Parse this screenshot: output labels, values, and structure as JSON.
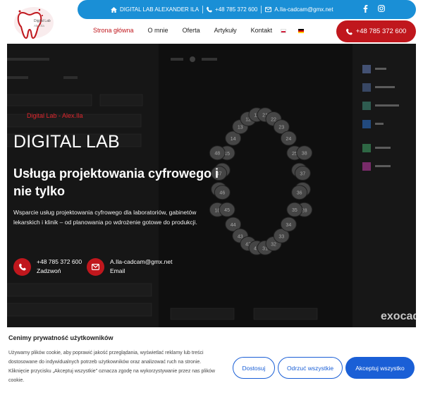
{
  "logo": {
    "text_main": "Digital Lab",
    "text_sub": "Alex.Ila"
  },
  "topbar": {
    "company": "DIGITAL LAB ALEXANDER ILA",
    "phone": "+48 785 372 600",
    "email": "A.Ila-cadcam@gmx.net",
    "social": [
      "facebook-icon",
      "instagram-icon"
    ]
  },
  "nav": {
    "items": [
      "Strona główna",
      "O mnie",
      "Oferta",
      "Artykuły",
      "Kontakt"
    ],
    "active_index": 0,
    "languages": [
      "pl",
      "de"
    ]
  },
  "cta": {
    "phone": "+48 785 372 600"
  },
  "hero": {
    "tagline": "Digital Lab - Alex.Ila",
    "title": "DIGITAL LAB",
    "subtitle": "Usługa projektowania cyfrowego i nie tylko",
    "description": "Wsparcie usług projektowania cyfrowego dla laboratoriów, gabinetów lekarskich i klinik – od planowania po wdrożenie gotowe do produkcji.",
    "contacts": [
      {
        "value": "+48 785 372 600",
        "label": "Zadzwoń"
      },
      {
        "value": "A.Ila-cadcam@gmx.net",
        "label": "Email"
      }
    ]
  },
  "screenshot_bg": {
    "toggle_left": "Patient",
    "toggle_right": "Multiple",
    "side_menu": [
      "CAD",
      "Multispace",
      "Model Creator",
      "CAM",
      "Supports",
      "Disclaim"
    ],
    "brand": "exocad",
    "tooth_numbers_upper": [
      "18",
      "17",
      "16",
      "15",
      "14",
      "13",
      "12",
      "11",
      "21",
      "22",
      "23",
      "24",
      "25",
      "26",
      "27",
      "28"
    ],
    "tooth_numbers_lower": [
      "48",
      "47",
      "46",
      "45",
      "44",
      "43",
      "42",
      "41",
      "31",
      "32",
      "33",
      "34",
      "35",
      "36",
      "37",
      "38"
    ]
  },
  "cookie": {
    "title": "Cenimy prywatność użytkowników",
    "text": "Używamy plików cookie, aby poprawić jakość przeglądania, wyświetlać reklamy lub treści dostosowane do indywidualnych potrzeb użytkowników oraz analizować ruch na stronie. Kliknięcie przycisku „Akceptuj wszystkie” oznacza zgodę na wykorzystywanie przez nas plików cookie.",
    "buttons": {
      "customize": "Dostosuj",
      "reject": "Odrzuć wszystkie",
      "accept": "Akceptuj wszystko"
    }
  },
  "colors": {
    "primary_red": "#c0171d",
    "topbar_blue": "#1a8fd6",
    "cookie_blue": "#1a5fd6"
  }
}
